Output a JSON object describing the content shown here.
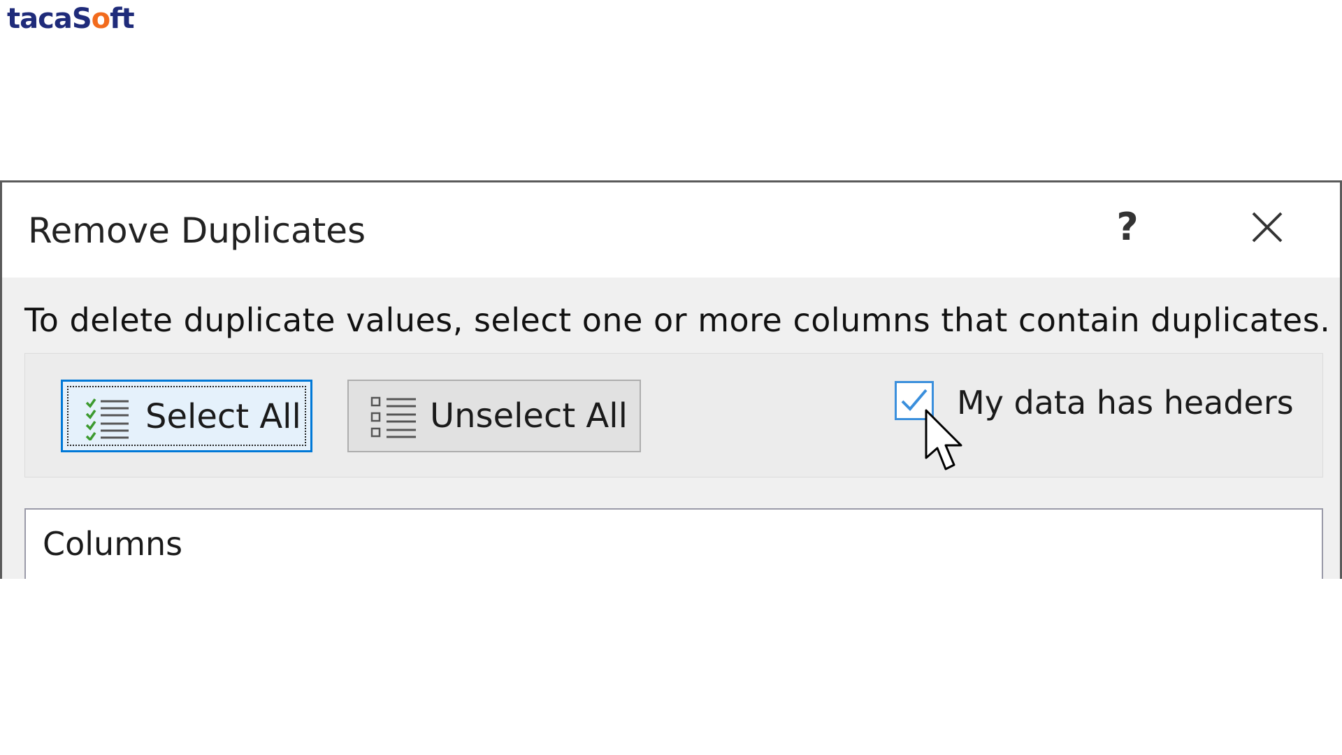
{
  "logo": {
    "text_before": "taca",
    "text_s": "S",
    "text_o": "o",
    "text_after": "ft"
  },
  "dialog": {
    "title": "Remove Duplicates",
    "help_label": "?",
    "close_icon": "close-icon",
    "instruction": "To delete duplicate values, select one or more columns that contain duplicates.",
    "select_all_label": "Select All",
    "select_all_icon": "checklist-icon",
    "unselect_all_label": "Unselect All",
    "unselect_all_icon": "unchecked-list-icon",
    "headers_checkbox": {
      "label": "My data has headers",
      "checked": true
    },
    "columns_header": "Columns"
  },
  "colors": {
    "accent": "#0078d7",
    "checkbox_border": "#3a8fdc",
    "logo_primary": "#1f2b7a",
    "logo_accent": "#f26b1d"
  }
}
